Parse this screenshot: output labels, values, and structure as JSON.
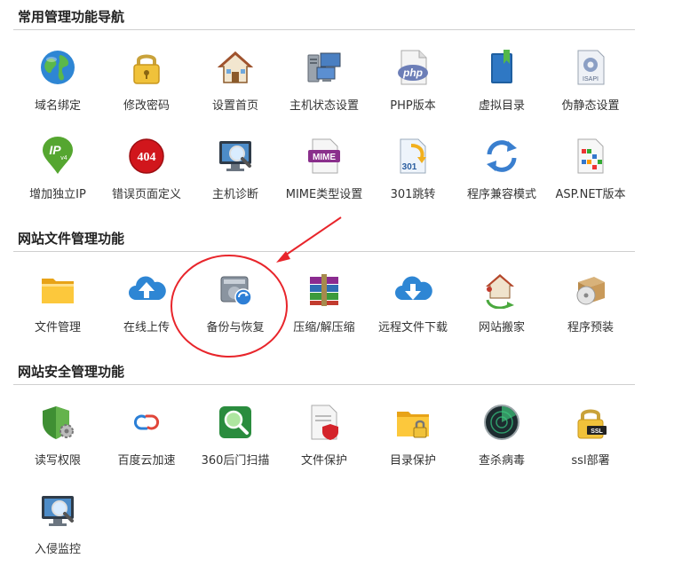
{
  "sections": [
    {
      "title": "常用管理功能导航",
      "items": [
        {
          "label": "域名绑定",
          "icon": "globe-icon"
        },
        {
          "label": "修改密码",
          "icon": "padlock-icon"
        },
        {
          "label": "设置首页",
          "icon": "house-icon"
        },
        {
          "label": "主机状态设置",
          "icon": "server-computers-icon"
        },
        {
          "label": "PHP版本",
          "icon": "php-file-icon"
        },
        {
          "label": "虚拟目录",
          "icon": "bookmark-book-icon"
        },
        {
          "label": "伪静态设置",
          "icon": "isapi-file-icon"
        },
        {
          "label": "增加独立IP",
          "icon": "ipv4-pin-icon"
        },
        {
          "label": "错误页面定义",
          "icon": "error-404-icon"
        },
        {
          "label": "主机诊断",
          "icon": "monitor-magnifier-icon"
        },
        {
          "label": "MIME类型设置",
          "icon": "mime-file-icon"
        },
        {
          "label": "301跳转",
          "icon": "redirect-301-icon"
        },
        {
          "label": "程序兼容模式",
          "icon": "refresh-arrows-icon"
        },
        {
          "label": "ASP.NET版本",
          "icon": "aspnet-file-icon"
        }
      ]
    },
    {
      "title": "网站文件管理功能",
      "items": [
        {
          "label": "文件管理",
          "icon": "folder-icon"
        },
        {
          "label": "在线上传",
          "icon": "cloud-upload-icon"
        },
        {
          "label": "备份与恢复",
          "icon": "backup-drive-icon"
        },
        {
          "label": "压缩/解压缩",
          "icon": "archive-books-icon"
        },
        {
          "label": "远程文件下载",
          "icon": "cloud-download-icon"
        },
        {
          "label": "网站搬家",
          "icon": "house-move-icon"
        },
        {
          "label": "程序预装",
          "icon": "package-disc-icon"
        }
      ]
    },
    {
      "title": "网站安全管理功能",
      "items": [
        {
          "label": "读写权限",
          "icon": "shield-gear-icon"
        },
        {
          "label": "百度云加速",
          "icon": "cloud-link-icon"
        },
        {
          "label": "360后门扫描",
          "icon": "scan-magnifier-icon"
        },
        {
          "label": "文件保护",
          "icon": "file-shield-icon"
        },
        {
          "label": "目录保护",
          "icon": "folder-lock-icon"
        },
        {
          "label": "查杀病毒",
          "icon": "virus-radar-icon"
        },
        {
          "label": "ssl部署",
          "icon": "ssl-lock-icon"
        },
        {
          "label": "入侵监控",
          "icon": "monitor-magnifier-icon"
        }
      ]
    }
  ],
  "icon_text": {
    "php": "php",
    "isapi": "ISAPI",
    "ip": "IP",
    "v4": "v4",
    "e404": "404",
    "mime": "MIME",
    "r301": "301",
    "ssl": "SSL"
  },
  "colors": {
    "annotation_red": "#e8252b",
    "divider": "#cfcfcf"
  }
}
